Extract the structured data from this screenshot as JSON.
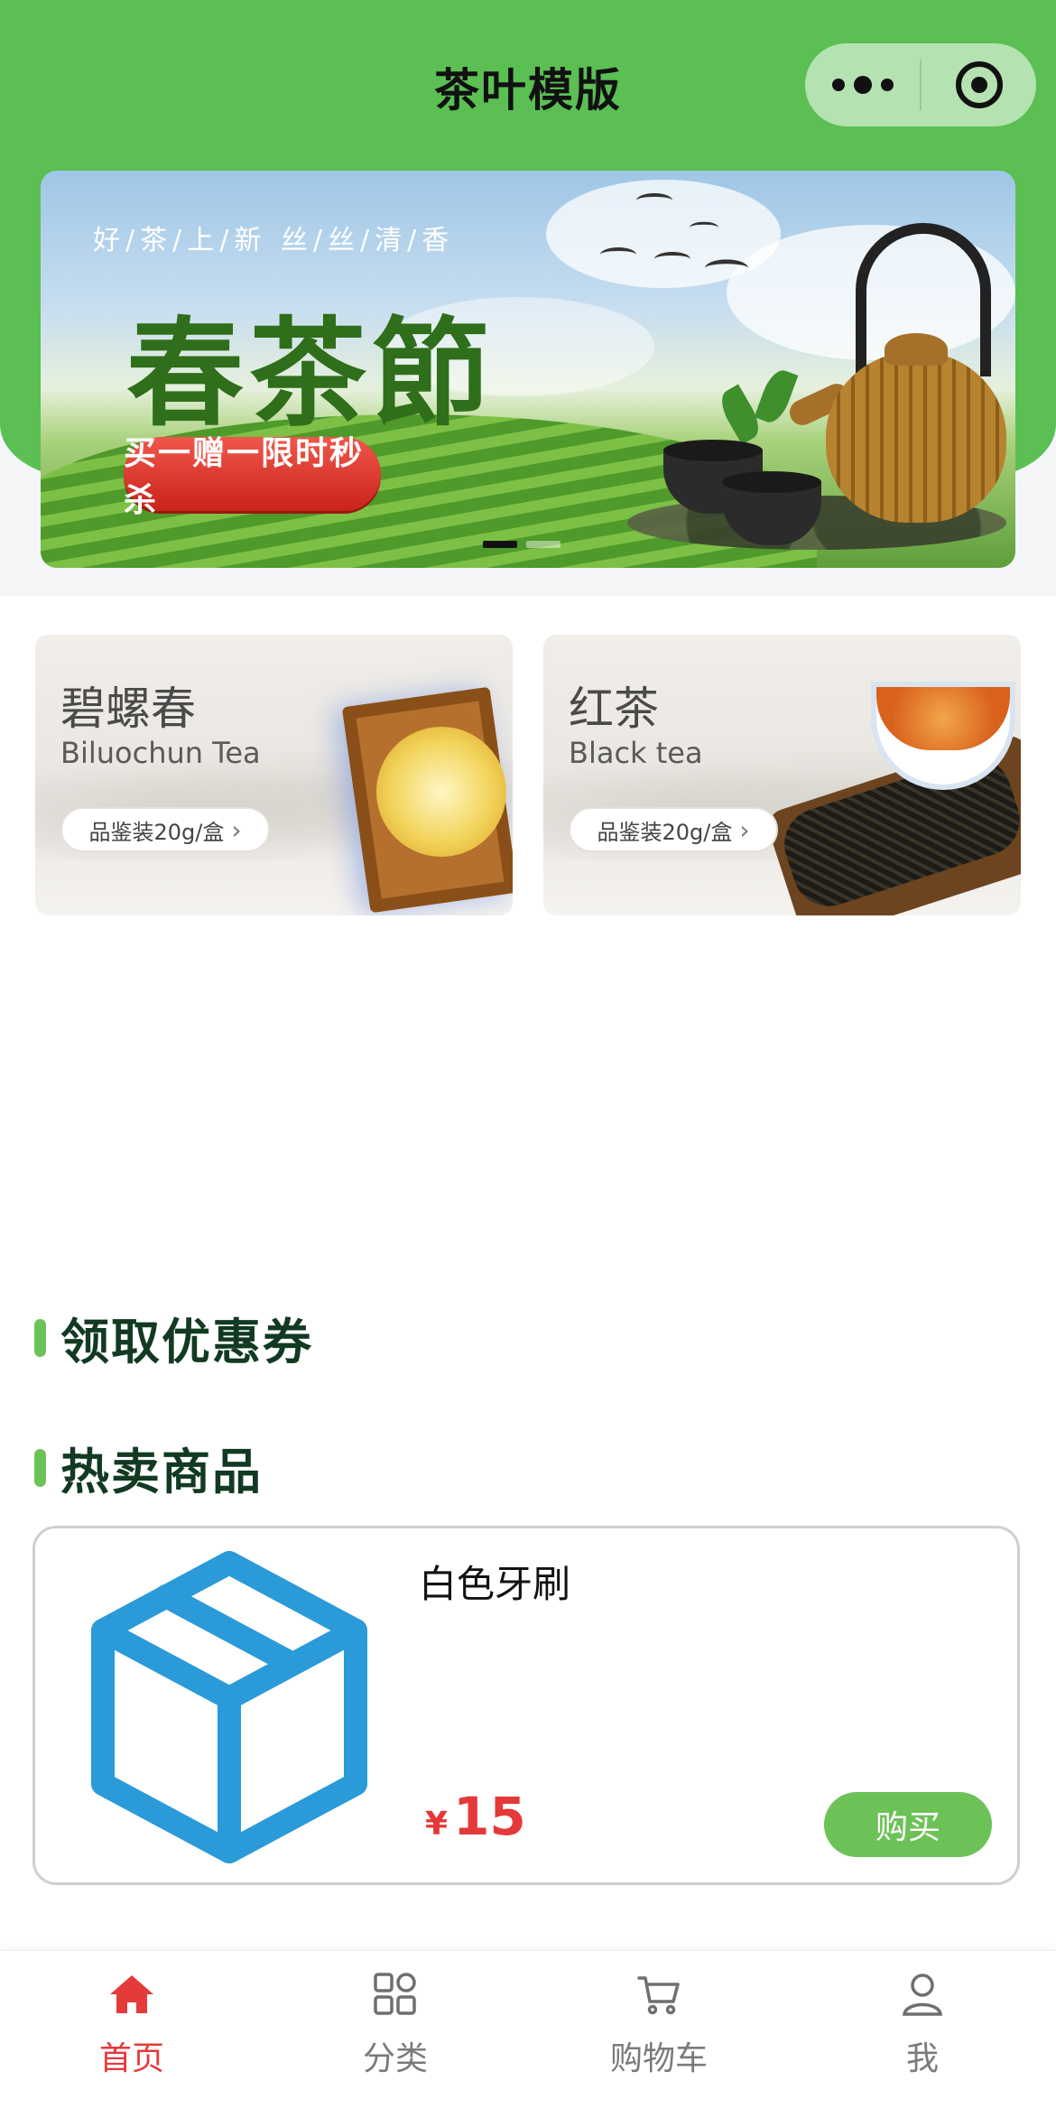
{
  "nav": {
    "title": "茶叶模版",
    "more_icon": "more-dots-icon",
    "close_icon": "target-close-icon"
  },
  "banner": {
    "tagline": "好/茶/上/新  丝/丝/清/香",
    "title": "春茶節",
    "cta": "买一赠一限时秒杀",
    "slides": 2,
    "active_slide": 1
  },
  "categories": [
    {
      "title": "碧螺春",
      "subtitle": "Biluochun Tea",
      "pill": "品鉴装20g/盒"
    },
    {
      "title": "红茶",
      "subtitle": "Black tea",
      "pill": "品鉴装20g/盒"
    }
  ],
  "sections": {
    "coupons": "领取优惠券",
    "hot": "热卖商品"
  },
  "products": [
    {
      "name": "白色牙刷",
      "currency": "¥",
      "price": "15",
      "buy_label": "购买",
      "image_icon": "box-icon"
    }
  ],
  "tabbar": {
    "items": [
      {
        "label": "首页",
        "icon": "home-icon",
        "active": true
      },
      {
        "label": "分类",
        "icon": "grid-icon",
        "active": false
      },
      {
        "label": "购物车",
        "icon": "cart-icon",
        "active": false
      },
      {
        "label": "我",
        "icon": "user-icon",
        "active": false
      }
    ]
  },
  "colors": {
    "brand_green": "#5bbf53",
    "accent_red": "#e53a3a",
    "button_green": "#6cc257"
  }
}
